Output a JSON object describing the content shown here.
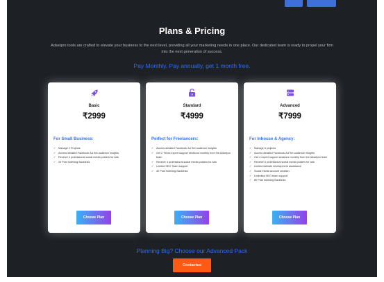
{
  "page": {
    "title": "Plans & Pricing",
    "intro": "Adsetpro tools are crafted to elevate your business to the next level, providing all your marketing needs in one place. Our dedicated team is ready to propel your firm into the next generation of success.",
    "offer": "Pay Monthly. Pay annually, get 1 month free.",
    "big_heading": "Planning Big? Choose our Advanced Pack",
    "contact_label": "Contactus"
  },
  "colors": {
    "background": "#1d2024",
    "accent_blue": "#2f6df6",
    "button_gradient_start": "#3ab1f5",
    "button_gradient_end": "#9640e8",
    "contact_orange": "#ff5a14",
    "icon_purple": "#7b4fe0"
  },
  "plans": [
    {
      "icon": "rocket-icon",
      "name": "Basic",
      "price": "₹2999",
      "audience": "For Small Business:",
      "features": [
        "Manage 2 Projects",
        "Access detailed Facebook Ad Set audience insights",
        "Receive 2 professional social media posters for Ads",
        "20 Post Indexing Backlinks"
      ],
      "button": "Choose Plan"
    },
    {
      "icon": "unlock-icon",
      "name": "Standard",
      "price": "₹4999",
      "audience": "Perfect for Freelancers:",
      "features": [
        "Access detailed Facebook Ad Set audience insights",
        "Get 2 Times expert support sessions monthly from the Adsetpro team",
        "Receive 4 professional social media posters for Ads",
        "Limited SEO Team support",
        "40 Post Indexing Backlinks"
      ],
      "button": "Choose Plan"
    },
    {
      "icon": "server-icon",
      "name": "Advanced",
      "price": "₹7999",
      "audience": "For Inhouse & Agency:",
      "features": [
        "Manage 6 projects",
        "Access detailed Facebook Ad Set audience insights",
        "Get 4 expert support sessions monthly from the Adsetpro team",
        "Receive 6 professional social media posters for ads",
        "Limited website development assistance",
        "Social media account creation",
        "Unlimited SEO team support",
        "80 Post Indexing Backlinks"
      ],
      "button": "Choose Plan"
    }
  ]
}
